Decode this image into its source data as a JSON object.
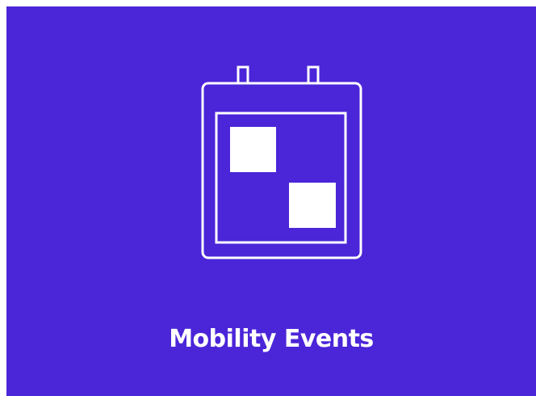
{
  "tile": {
    "label": "Mobility Events",
    "icon": "calendar-icon",
    "background_color": "#4b25d8",
    "foreground_color": "#ffffff"
  }
}
